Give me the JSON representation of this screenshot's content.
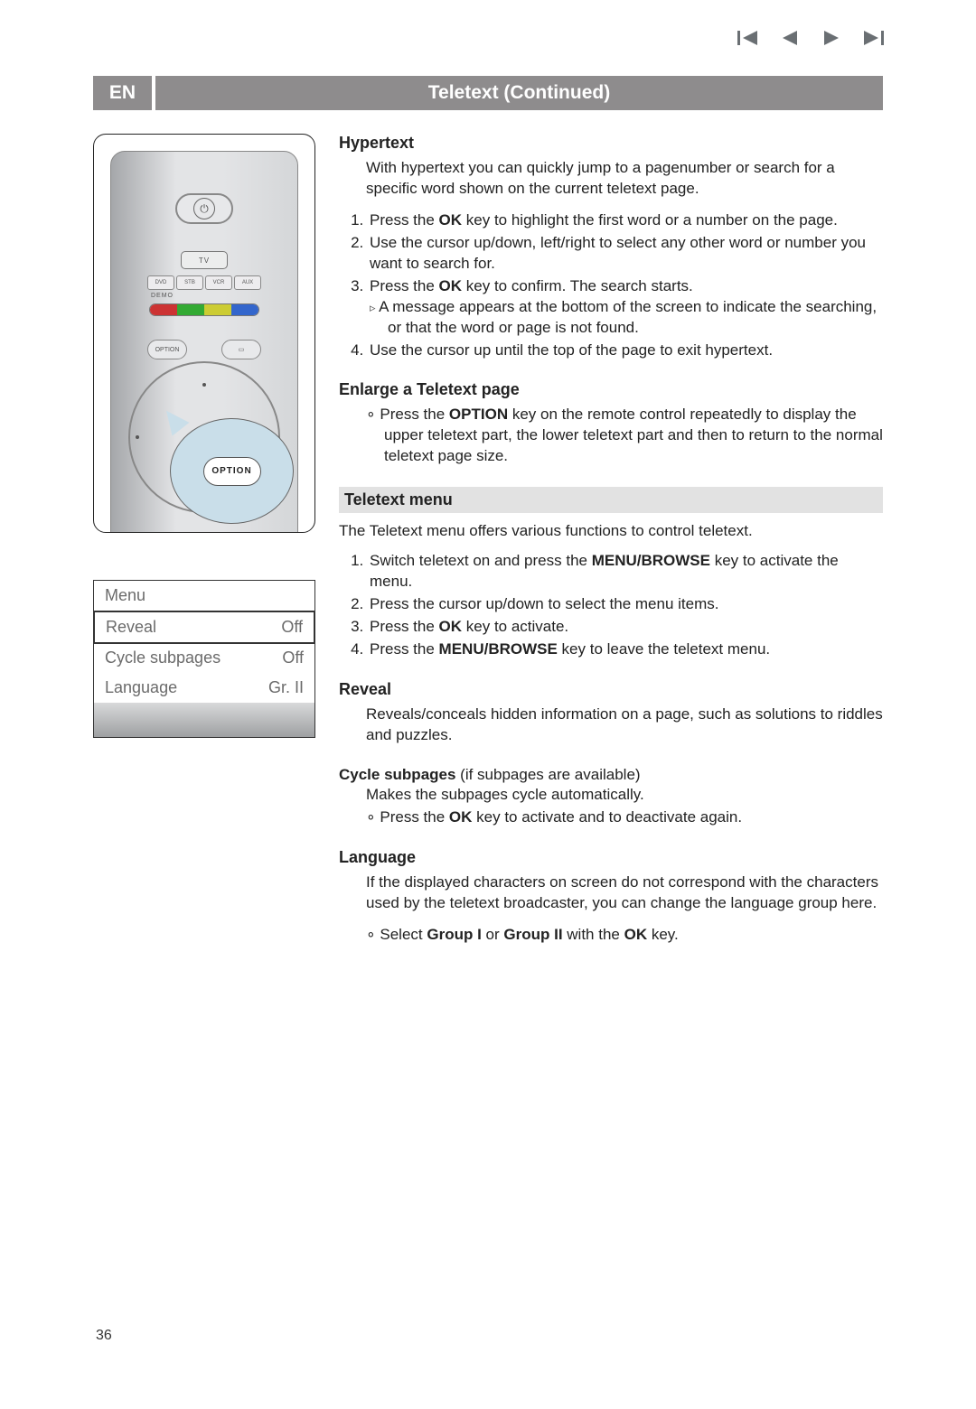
{
  "header": {
    "lang_tab": "EN",
    "title": "Teletext  (Continued)"
  },
  "remote": {
    "tv": "TV",
    "sources": [
      "DVD",
      "STB",
      "VCR",
      "AUX"
    ],
    "demo": "DEMO",
    "colors": [
      "#c33",
      "#3a3",
      "#cc3",
      "#36c"
    ],
    "option_btn": "OPTION",
    "bubble_label": "OPTION"
  },
  "menu_panel": {
    "title": "Menu",
    "rows": [
      {
        "label": "Reveal",
        "value": "Off",
        "highlight": true
      },
      {
        "label": "Cycle subpages",
        "value": "Off",
        "highlight": false
      },
      {
        "label": "Language",
        "value": "Gr. II",
        "highlight": false
      }
    ]
  },
  "sections": {
    "hypertext": {
      "heading": "Hypertext",
      "intro": "With hypertext you can quickly jump to a pagenumber or search for a specific word shown on the current teletext page.",
      "step1a": "Press the ",
      "step1b": "OK",
      "step1c": " key to highlight the first word or a number on the page.",
      "step2": "Use the cursor up/down, left/right to select any other word or number you want to search for.",
      "step3a": "Press the ",
      "step3b": "OK",
      "step3c": " key to confirm. The search starts.",
      "step3_sub": "A message appears at the bottom of the screen to indicate the searching, or that the word or page is not found.",
      "step4": "Use the cursor up until the top of the page to exit hypertext."
    },
    "enlarge": {
      "heading": "Enlarge a Teletext page",
      "bullet_a": "Press the ",
      "bullet_b": "OPTION",
      "bullet_c": " key on the remote control repeatedly to display the upper teletext part, the lower teletext part and then to return to the normal teletext page size."
    },
    "teletext_menu": {
      "heading": "Teletext menu",
      "intro": "The Teletext menu offers various functions to control teletext.",
      "step1a": "Switch teletext on and press the ",
      "step1b": "MENU/BROWSE",
      "step1c": " key to activate the menu.",
      "step2": "Press the cursor up/down to select the menu items.",
      "step3a": "Press the ",
      "step3b": "OK",
      "step3c": " key to activate.",
      "step4a": "Press the ",
      "step4b": "MENU/BROWSE",
      "step4c": " key to leave the teletext menu."
    },
    "reveal": {
      "heading": "Reveal",
      "body": "Reveals/conceals hidden information on a page, such as solutions to riddles and puzzles."
    },
    "cycle": {
      "heading_a": "Cycle subpages",
      "heading_b": " (if subpages are available)",
      "line1": "Makes the subpages cycle automatically.",
      "bullet_a": "Press the ",
      "bullet_b": "OK",
      "bullet_c": " key to activate and to deactivate again."
    },
    "language": {
      "heading": "Language",
      "body": "If the displayed characters on screen do not correspond with the characters used by the teletext broadcaster, you can change the language group here.",
      "bullet_a": "Select ",
      "bullet_b": "Group I",
      "bullet_c": " or ",
      "bullet_d": "Group II",
      "bullet_e": " with the ",
      "bullet_f": "OK",
      "bullet_g": " key."
    }
  },
  "page_number": "36"
}
